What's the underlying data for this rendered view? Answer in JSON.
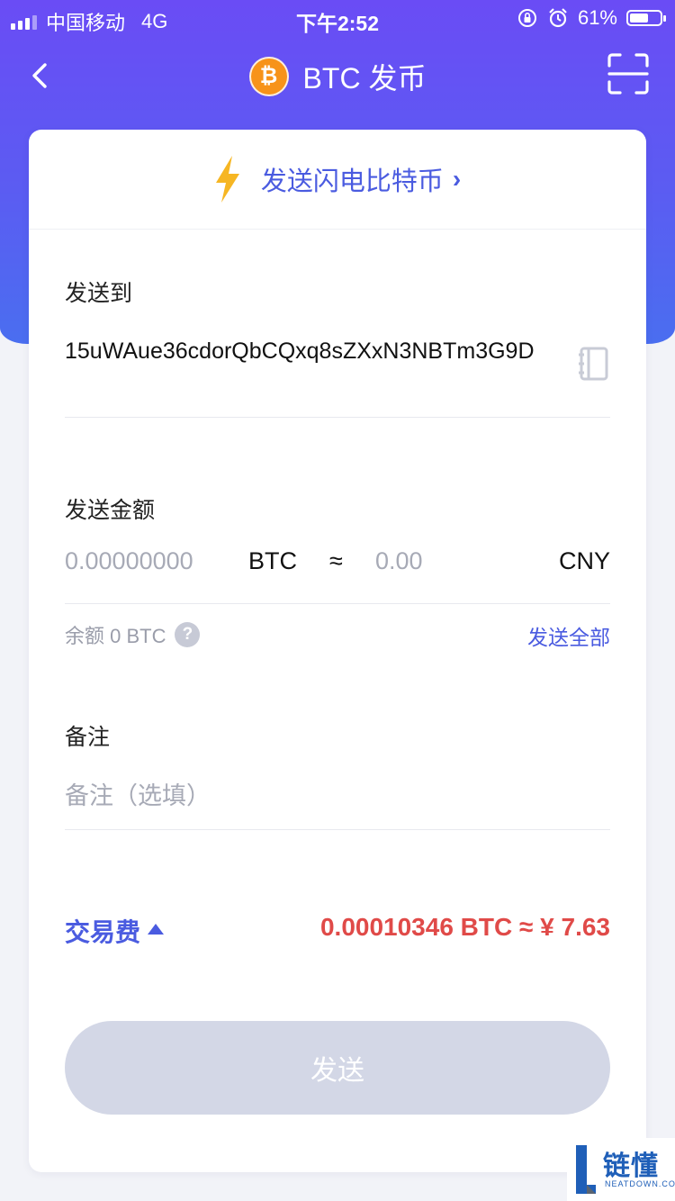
{
  "status_bar": {
    "carrier": "中国移动",
    "network": "4G",
    "time": "下午2:52",
    "battery": "61%",
    "battery_level": 0.61
  },
  "nav": {
    "title": "BTC 发币",
    "coin_symbol": "₿",
    "back_icon": "chevron-left-icon",
    "scan_icon": "scan-icon"
  },
  "lightning": {
    "label": "发送闪电比特币",
    "chevron": "›"
  },
  "recipient": {
    "label": "发送到",
    "address": "15uWAue36cdorQbCQxq8sZXxN3NBTm3G9D",
    "book_icon": "address-book-icon"
  },
  "amount": {
    "label": "发送金额",
    "btc_placeholder": "0.00000000",
    "btc_unit": "BTC",
    "approx": "≈",
    "cny_placeholder": "0.00",
    "cny_unit": "CNY",
    "balance": "余额 0 BTC",
    "help": "?",
    "send_all": "发送全部"
  },
  "memo": {
    "label": "备注",
    "placeholder": "备注（选填）"
  },
  "fee": {
    "label": "交易费",
    "value": "0.00010346 BTC ≈ ¥ 7.63"
  },
  "send_button": "发送",
  "watermark": {
    "text": "链懂",
    "sub": "NEATDOWN.COM"
  },
  "colors": {
    "header_gradient_top": "#6a4cf5",
    "header_gradient_bottom": "#4a6ef0",
    "accent_blue": "#4a5be0",
    "fee_red": "#e04a48",
    "lightning_yellow": "#f6b623",
    "btc_orange": "#f7931a",
    "disabled_button": "#d3d7e6"
  }
}
